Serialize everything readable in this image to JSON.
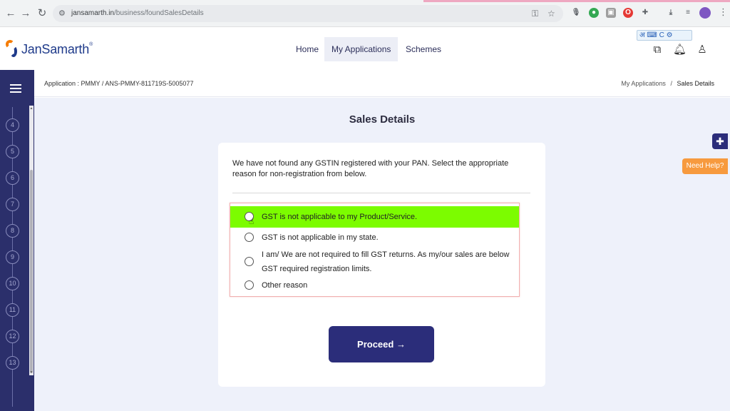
{
  "browser": {
    "url_domain": "jansamarth.in",
    "url_path": "/business/foundSalesDetails",
    "lang_toolbar": "अ ⌨ C ⚙"
  },
  "header": {
    "logo_text": "JanSamarth",
    "logo_tm": "®",
    "nav": [
      {
        "label": "Home",
        "active": false
      },
      {
        "label": "My Applications",
        "active": true
      },
      {
        "label": "Schemes",
        "active": false
      }
    ]
  },
  "sidebar": {
    "steps": [
      "4",
      "5",
      "6",
      "7",
      "8",
      "9",
      "10",
      "11",
      "12",
      "13"
    ]
  },
  "breadcrumb": {
    "application_id": "Application : PMMY / ANS-PMMY-811719S-5005077",
    "parent": "My Applications",
    "separator": "/",
    "current": "Sales Details"
  },
  "page": {
    "title": "Sales Details",
    "message": "We have not found any GSTIN registered with your PAN. Select the appropriate reason for non-registration from below.",
    "options": [
      {
        "label": "GST is not applicable to my Product/Service.",
        "highlighted": true
      },
      {
        "label": "GST is not applicable in my state.",
        "highlighted": false
      },
      {
        "label": "I am/ We are not required to fill GST returns. As my/our sales are below GST required registration limits.",
        "highlighted": false
      },
      {
        "label": "Other reason",
        "highlighted": false
      }
    ],
    "proceed_label": "Proceed →"
  },
  "floating": {
    "help_label": "Need Help?"
  },
  "colors": {
    "primary": "#2b2d7a",
    "sidebar": "#2b2f6b",
    "highlight": "#7cfc00",
    "help": "#f79a3e"
  }
}
